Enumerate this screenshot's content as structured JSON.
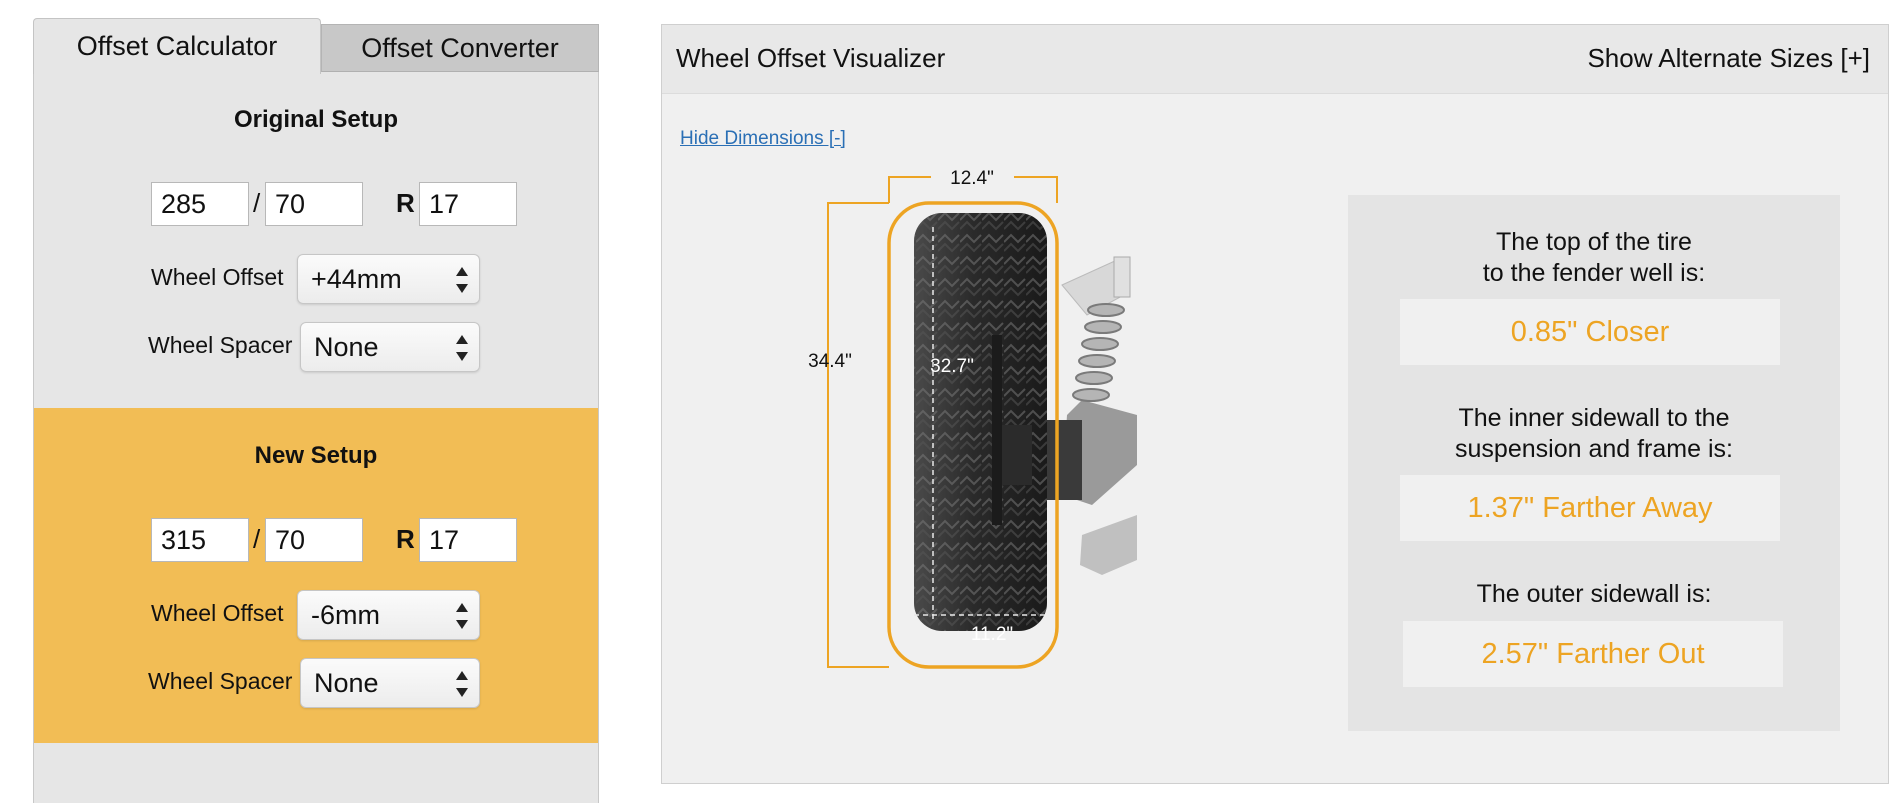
{
  "tabs": {
    "calculator": "Offset Calculator",
    "converter": "Offset Converter"
  },
  "original": {
    "title": "Original Setup",
    "width": "285",
    "aspect": "70",
    "rim": "17",
    "slash": "/",
    "r": "R",
    "offset_label": "Wheel Offset",
    "offset_value": "+44mm",
    "spacer_label": "Wheel Spacer",
    "spacer_value": "None"
  },
  "new": {
    "title": "New Setup",
    "width": "315",
    "aspect": "70",
    "rim": "17",
    "slash": "/",
    "r": "R",
    "offset_label": "Wheel Offset",
    "offset_value": "-6mm",
    "spacer_label": "Wheel Spacer",
    "spacer_value": "None"
  },
  "visualizer": {
    "title": "Wheel Offset Visualizer",
    "alternate_toggle": "Show Alternate Sizes [+]",
    "hide_dimensions": "Hide Dimensions [-]",
    "dims": {
      "overall_width": "12.4\"",
      "overall_height": "34.4\"",
      "original_height": "32.7\"",
      "original_width": "11.2\""
    },
    "results": [
      {
        "label_line1": "The top of the tire",
        "label_line2": "to the fender well is:",
        "value": "0.85\" Closer"
      },
      {
        "label_line1": "The inner sidewall to the",
        "label_line2": "suspension and frame is:",
        "value": "1.37\" Farther Away"
      },
      {
        "label_line1": "The outer sidewall is:",
        "label_line2": "",
        "value": "2.57\" Farther Out"
      }
    ]
  },
  "colors": {
    "accent_orange": "#eda423",
    "new_setup_bg": "#f2bd55",
    "link_blue": "#2a6fb5"
  }
}
